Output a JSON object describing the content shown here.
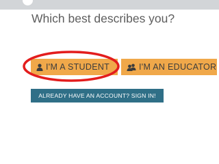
{
  "header": {
    "question": "Which best describes you?"
  },
  "roles": {
    "student": {
      "label": "I'M A STUDENT",
      "icon": "student-person-icon"
    },
    "educator": {
      "label": "I'M AN EDUCATOR",
      "icon": "educator-group-icon"
    }
  },
  "signin": {
    "label": "ALREADY HAVE AN ACCOUNT? SIGN IN!"
  },
  "colors": {
    "role_button_bg": "#f0a84a",
    "signin_button_bg": "#2f6f87",
    "highlight_ring": "#e31d1d",
    "banner_bg": "#d2d5d8"
  }
}
